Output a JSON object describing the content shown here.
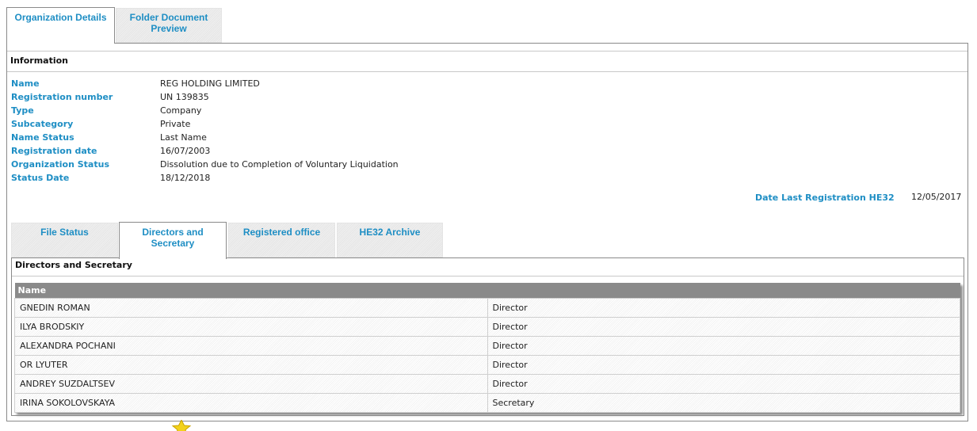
{
  "top_tabs": [
    {
      "label": "Organization Details",
      "active": true
    },
    {
      "label": "Folder Document Preview",
      "active": false
    }
  ],
  "info": {
    "heading": "Information",
    "fields": [
      {
        "label": "Name",
        "value": "REG HOLDING LIMITED"
      },
      {
        "label": "Registration number",
        "value": "UN 139835"
      },
      {
        "label": "Type",
        "value": "Company"
      },
      {
        "label": "Subcategory",
        "value": "Private"
      },
      {
        "label": "Name Status",
        "value": "Last Name"
      },
      {
        "label": "Registration date",
        "value": "16/07/2003"
      },
      {
        "label": "Organization Status",
        "value": "Dissolution due to Completion of Voluntary Liquidation"
      },
      {
        "label": "Status Date",
        "value": "18/12/2018"
      }
    ],
    "last_registration": {
      "label": "Date Last Registration HE32",
      "value": "12/05/2017"
    }
  },
  "inner_tabs": [
    {
      "label": "File Status",
      "active": false
    },
    {
      "label": "Directors and Secretary",
      "active": true
    },
    {
      "label": "Registered office",
      "active": false
    },
    {
      "label": "HE32 Archive",
      "active": false
    }
  ],
  "directors": {
    "heading": "Directors and Secretary",
    "column_header": "Name",
    "rows": [
      {
        "name": "GNEDIN ROMAN",
        "role": "Director"
      },
      {
        "name": "ILYA BRODSKIY",
        "role": "Director"
      },
      {
        "name": "ALEXANDRA POCHANI",
        "role": "Director"
      },
      {
        "name": "OR LYUTER",
        "role": "Director"
      },
      {
        "name": "ANDREY SUZDALTSEV",
        "role": "Director"
      },
      {
        "name": "IRINA SOKOLOVSKAYA",
        "role": "Secretary"
      }
    ]
  },
  "colors": {
    "accent": "#1e8ec4",
    "header_bg": "#8a8a8a"
  },
  "icons": {
    "footer": "star-icon"
  }
}
